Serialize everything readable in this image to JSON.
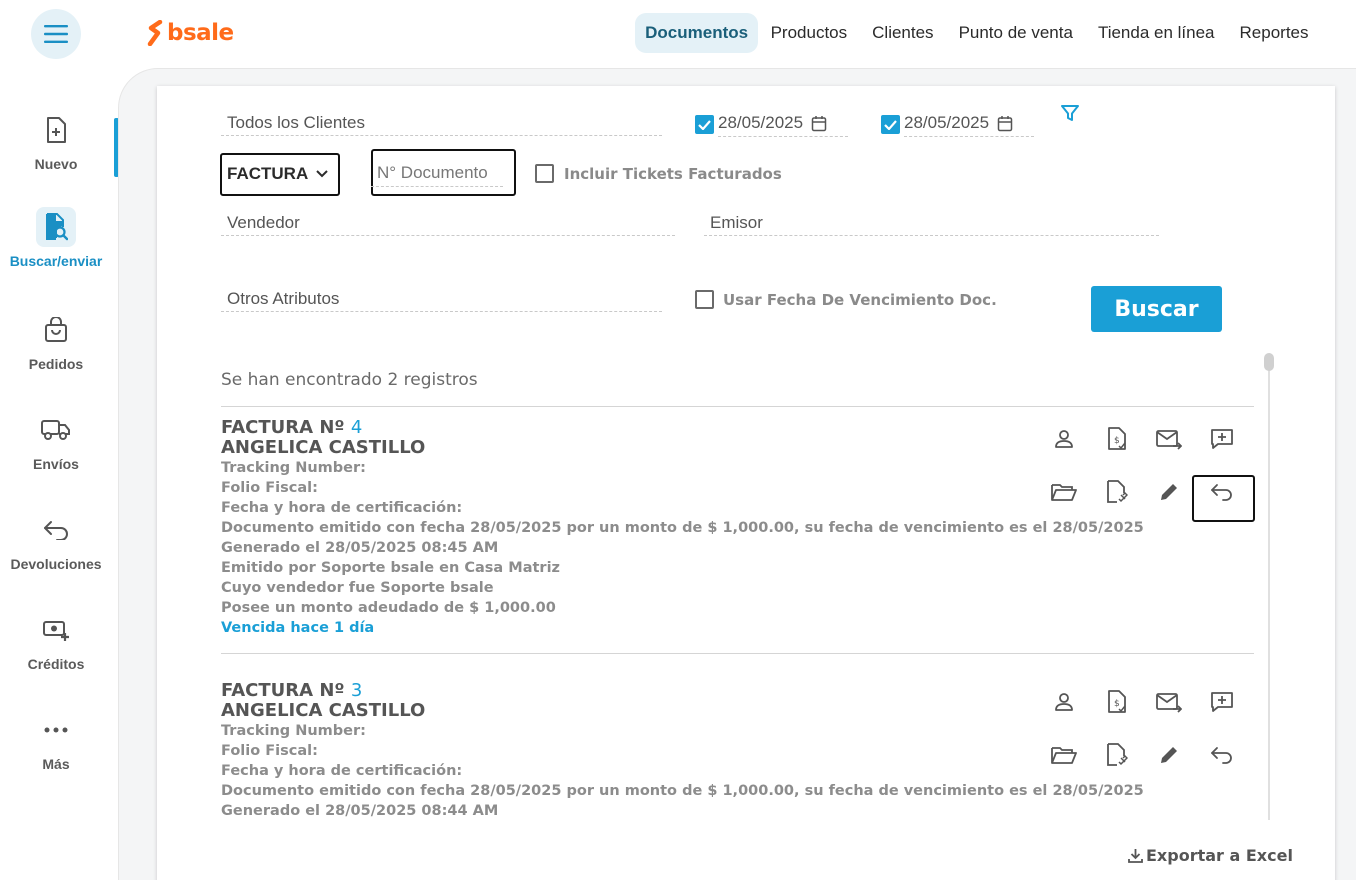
{
  "brand": {
    "logo_text": "bsale",
    "logo_color": "#ff6b1a",
    "accent": "#1a9fd6"
  },
  "topnav": {
    "items": [
      "Documentos",
      "Productos",
      "Clientes",
      "Punto de venta",
      "Tienda en línea",
      "Reportes"
    ],
    "active": "Documentos"
  },
  "sidebar": {
    "items": [
      {
        "label": "Nuevo",
        "icon": "file-plus-icon"
      },
      {
        "label": "Buscar/enviar",
        "icon": "file-search-icon",
        "active": true
      },
      {
        "label": "Pedidos",
        "icon": "shopping-bag-icon"
      },
      {
        "label": "Envíos",
        "icon": "truck-icon"
      },
      {
        "label": "Devoluciones",
        "icon": "return-arrow-icon"
      },
      {
        "label": "Créditos",
        "icon": "cash-plus-icon"
      },
      {
        "label": "Más",
        "icon": "more-dots-icon"
      }
    ]
  },
  "filters": {
    "client": "Todos los Clientes",
    "date_from": "28/05/2025",
    "date_to": "28/05/2025",
    "doc_type": "FACTURA",
    "doc_number_placeholder": "N° Documento",
    "include_tickets_label": "Incluir Tickets Facturados",
    "seller": "Vendedor",
    "issuer": "Emisor",
    "other_attributes": "Otros Atributos",
    "use_due_date_label": "Usar Fecha De Vencimiento Doc.",
    "search_button": "Buscar"
  },
  "results": {
    "count_text": "Se han encontrado 2 registros",
    "records": [
      {
        "type": "FACTURA Nº",
        "number": "4",
        "client": "ANGELICA CASTILLO",
        "lines": [
          "Tracking Number:",
          "Folio Fiscal:",
          "Fecha y hora de certificación:",
          "Documento emitido con fecha 28/05/2025 por un monto de $ 1,000.00, su fecha de vencimiento es el 28/05/2025",
          "Generado el 28/05/2025 08:45 AM",
          "Emitido por Soporte bsale en Casa Matriz",
          "Cuyo vendedor fue Soporte bsale",
          "Posee un monto adeudado de $ 1,000.00"
        ],
        "status": "Vencida hace 1 día"
      },
      {
        "type": "FACTURA Nº",
        "number": "3",
        "client": "ANGELICA CASTILLO",
        "lines": [
          "Tracking Number:",
          "Folio Fiscal:",
          "Fecha y hora de certificación:",
          "Documento emitido con fecha 28/05/2025 por un monto de $ 1,000.00, su fecha de vencimiento es el 28/05/2025",
          "Generado el 28/05/2025 08:44 AM"
        ]
      }
    ]
  },
  "export_label": "Exportar a Excel"
}
